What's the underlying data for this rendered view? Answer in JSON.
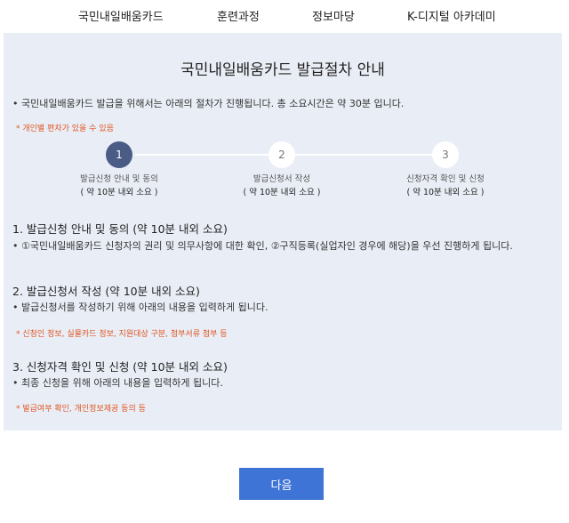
{
  "nav": {
    "items": [
      {
        "label": "국민내일배움카드"
      },
      {
        "label": "훈련과정"
      },
      {
        "label": "정보마당"
      },
      {
        "label": "K-디지털 아카데미"
      }
    ]
  },
  "main": {
    "title": "국민내일배움카드 발급절차 안내",
    "note": "• 국민내일배움카드 발급을 위해서는 아래의 절차가 진행됩니다. 총 소요시간은 약 30분 입니다.",
    "warning": "* 개인별 편차가 있을 수 있음",
    "steps": [
      {
        "number": "1",
        "label": "발급신청 안내 및 동의",
        "duration": "( 약 10분 내외 소요 )"
      },
      {
        "number": "2",
        "label": "발급신청서 작성",
        "duration": "( 약 10분 내외 소요 )"
      },
      {
        "number": "3",
        "label": "신청자격 확인 및 신청",
        "duration": "( 약 10분 내외 소요 )"
      }
    ],
    "sections": [
      {
        "heading": "1. 발급신청 안내 및 동의 (약 10분 내외 소요)",
        "desc": "• ①국민내일배움카드 신청자의 권리 및 의무사항에 대한 확인, ②구직등록(실업자인 경우에 해당)을 우선 진행하게 됩니다."
      },
      {
        "heading": "2. 발급신청서 작성 (약 10분 내외 소요)",
        "desc": "• 발급신청서를 작성하기 위해 아래의 내용을 입력하게 됩니다.",
        "note": "* 신청인 정보, 실물카드 정보, 지원대상 구분, 첨부서류 첨부 등"
      },
      {
        "heading": "3. 신청자격 확인 및 신청 (약 10분 내외 소요)",
        "desc": "• 최종 신청을 위해 아래의 내용을 입력하게 됩니다.",
        "note": "* 발급여부 확인, 개인정보제공 동의 등"
      }
    ]
  },
  "footer": {
    "next_label": "다음",
    "button_color": "#3e74d6"
  },
  "colors": {
    "panel_bg": "#e9eef6",
    "active_step": "#4a5b86",
    "warning_text": "#e0531f"
  }
}
